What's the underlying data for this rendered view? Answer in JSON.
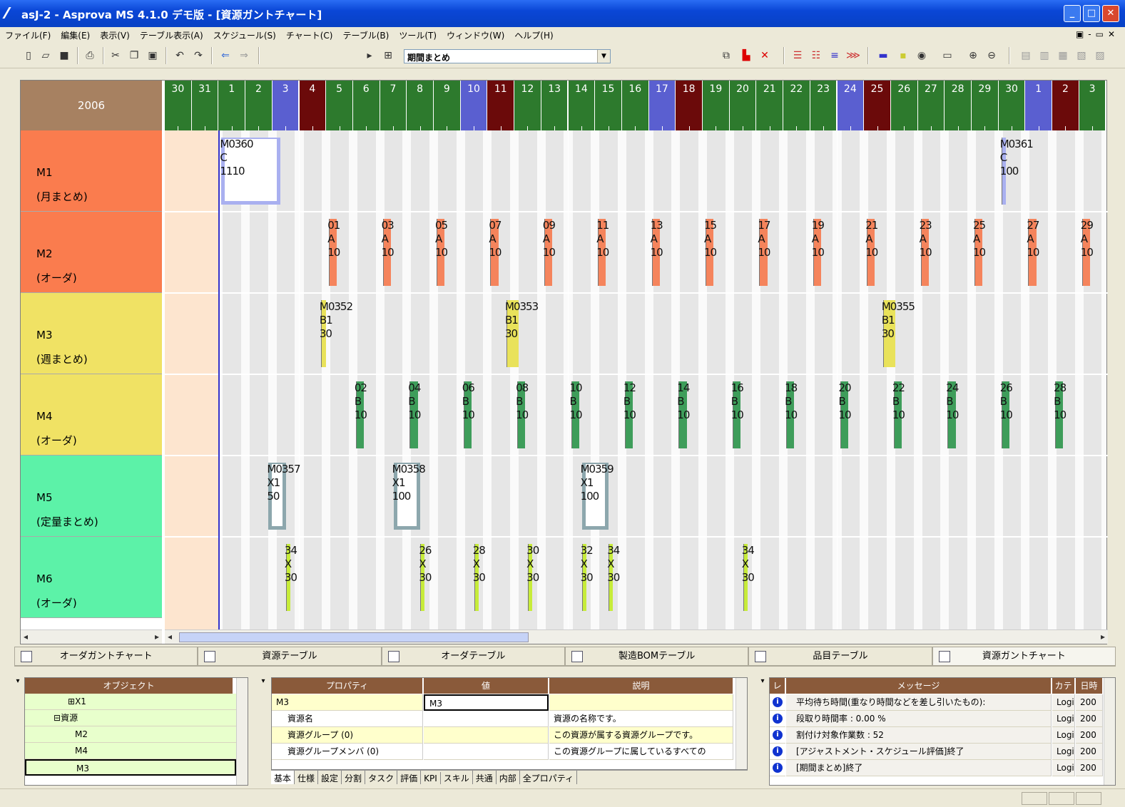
{
  "window": {
    "title": "asJ-2 - Asprova MS 4.1.0 デモ版 - [資源ガントチャート]"
  },
  "menu": [
    "ファイル(F)",
    "編集(E)",
    "表示(V)",
    "テーブル表示(A)",
    "スケジュール(S)",
    "チャート(C)",
    "テーブル(B)",
    "ツール(T)",
    "ウィンドウ(W)",
    "ヘルプ(H)"
  ],
  "toolbar": {
    "combo_value": "期間まとめ"
  },
  "gantt": {
    "year": "2006",
    "days": [
      {
        "d": "30",
        "c": "#2d7a2d"
      },
      {
        "d": "31",
        "c": "#2d7a2d"
      },
      {
        "d": "1",
        "c": "#2d7a2d"
      },
      {
        "d": "2",
        "c": "#2d7a2d"
      },
      {
        "d": "3",
        "c": "#5a5fd0"
      },
      {
        "d": "4",
        "c": "#6b0a0a"
      },
      {
        "d": "5",
        "c": "#2d7a2d"
      },
      {
        "d": "6",
        "c": "#2d7a2d"
      },
      {
        "d": "7",
        "c": "#2d7a2d"
      },
      {
        "d": "8",
        "c": "#2d7a2d"
      },
      {
        "d": "9",
        "c": "#2d7a2d"
      },
      {
        "d": "10",
        "c": "#5a5fd0"
      },
      {
        "d": "11",
        "c": "#6b0a0a"
      },
      {
        "d": "12",
        "c": "#2d7a2d"
      },
      {
        "d": "13",
        "c": "#2d7a2d"
      },
      {
        "d": "14",
        "c": "#2d7a2d"
      },
      {
        "d": "15",
        "c": "#2d7a2d"
      },
      {
        "d": "16",
        "c": "#2d7a2d"
      },
      {
        "d": "17",
        "c": "#5a5fd0"
      },
      {
        "d": "18",
        "c": "#6b0a0a"
      },
      {
        "d": "19",
        "c": "#2d7a2d"
      },
      {
        "d": "20",
        "c": "#2d7a2d"
      },
      {
        "d": "21",
        "c": "#2d7a2d"
      },
      {
        "d": "22",
        "c": "#2d7a2d"
      },
      {
        "d": "23",
        "c": "#2d7a2d"
      },
      {
        "d": "24",
        "c": "#5a5fd0"
      },
      {
        "d": "25",
        "c": "#6b0a0a"
      },
      {
        "d": "26",
        "c": "#2d7a2d"
      },
      {
        "d": "27",
        "c": "#2d7a2d"
      },
      {
        "d": "28",
        "c": "#2d7a2d"
      },
      {
        "d": "29",
        "c": "#2d7a2d"
      },
      {
        "d": "30",
        "c": "#2d7a2d"
      },
      {
        "d": "1",
        "c": "#5a5fd0"
      },
      {
        "d": "2",
        "c": "#6b0a0a"
      },
      {
        "d": "3",
        "c": "#2d7a2d"
      }
    ],
    "resources": [
      {
        "name": "M1",
        "sub": "(月まとめ)",
        "color": "#fa7c4e"
      },
      {
        "name": "M2",
        "sub": "(オーダ)",
        "color": "#fa7c4e"
      },
      {
        "name": "M3",
        "sub": "(週まとめ)",
        "color": "#f0e264"
      },
      {
        "name": "M4",
        "sub": "(オーダ)",
        "color": "#f0e264"
      },
      {
        "name": "M5",
        "sub": "(定量まとめ)",
        "color": "#5cf2a8"
      },
      {
        "name": "M6",
        "sub": "(オーダ)",
        "color": "#5cf2a8"
      }
    ],
    "tasks": [
      {
        "row": 0,
        "day": 2,
        "w": 2.2,
        "text": "M0360\nC\n1110",
        "color": "#a9b0f0",
        "hollow": true
      },
      {
        "row": 0,
        "day": 31,
        "w": 0.15,
        "text": "M0361\nC\n100",
        "color": "#a9b0f0",
        "hollow": false
      },
      {
        "row": 1,
        "day": 6,
        "w": 0.3,
        "text": "01\nA\n10",
        "color": "#f5845c"
      },
      {
        "row": 1,
        "day": 8,
        "w": 0.3,
        "text": "03\nA\n10",
        "color": "#f5845c"
      },
      {
        "row": 1,
        "day": 10,
        "w": 0.3,
        "text": "05\nA\n10",
        "color": "#f5845c"
      },
      {
        "row": 1,
        "day": 12,
        "w": 0.3,
        "text": "07\nA\n10",
        "color": "#f5845c"
      },
      {
        "row": 1,
        "day": 14,
        "w": 0.3,
        "text": "09\nA\n10",
        "color": "#f5845c"
      },
      {
        "row": 1,
        "day": 16,
        "w": 0.3,
        "text": "11\nA\n10",
        "color": "#f5845c"
      },
      {
        "row": 1,
        "day": 18,
        "w": 0.3,
        "text": "13\nA\n10",
        "color": "#f5845c"
      },
      {
        "row": 1,
        "day": 20,
        "w": 0.3,
        "text": "15\nA\n10",
        "color": "#f5845c"
      },
      {
        "row": 1,
        "day": 22,
        "w": 0.3,
        "text": "17\nA\n10",
        "color": "#f5845c"
      },
      {
        "row": 1,
        "day": 24,
        "w": 0.3,
        "text": "19\nA\n10",
        "color": "#f5845c"
      },
      {
        "row": 1,
        "day": 26,
        "w": 0.3,
        "text": "21\nA\n10",
        "color": "#f5845c"
      },
      {
        "row": 1,
        "day": 28,
        "w": 0.3,
        "text": "23\nA\n10",
        "color": "#f5845c"
      },
      {
        "row": 1,
        "day": 30,
        "w": 0.3,
        "text": "25\nA\n10",
        "color": "#f5845c"
      },
      {
        "row": 1,
        "day": 32,
        "w": 0.3,
        "text": "27\nA\n10",
        "color": "#f5845c"
      },
      {
        "row": 1,
        "day": 34,
        "w": 0.3,
        "text": "29\nA\n10",
        "color": "#f5845c"
      },
      {
        "row": 2,
        "day": 5.7,
        "w": 0.2,
        "text": "M0352\nB1\n30",
        "color": "#e9e25a"
      },
      {
        "row": 2,
        "day": 12.6,
        "w": 0.45,
        "text": "M0353\nB1\n30",
        "color": "#e9e25a"
      },
      {
        "row": 2,
        "day": 26.6,
        "w": 0.45,
        "text": "M0355\nB1\n30",
        "color": "#e9e25a"
      },
      {
        "row": 3,
        "day": 7,
        "w": 0.3,
        "text": "02\nB\n10",
        "color": "#3e9d5a"
      },
      {
        "row": 3,
        "day": 9,
        "w": 0.3,
        "text": "04\nB\n10",
        "color": "#3e9d5a"
      },
      {
        "row": 3,
        "day": 11,
        "w": 0.3,
        "text": "06\nB\n10",
        "color": "#3e9d5a"
      },
      {
        "row": 3,
        "day": 13,
        "w": 0.3,
        "text": "08\nB\n10",
        "color": "#3e9d5a"
      },
      {
        "row": 3,
        "day": 15,
        "w": 0.3,
        "text": "10\nB\n10",
        "color": "#3e9d5a"
      },
      {
        "row": 3,
        "day": 17,
        "w": 0.3,
        "text": "12\nB\n10",
        "color": "#3e9d5a"
      },
      {
        "row": 3,
        "day": 19,
        "w": 0.3,
        "text": "14\nB\n10",
        "color": "#3e9d5a"
      },
      {
        "row": 3,
        "day": 21,
        "w": 0.3,
        "text": "16\nB\n10",
        "color": "#3e9d5a"
      },
      {
        "row": 3,
        "day": 23,
        "w": 0.3,
        "text": "18\nB\n10",
        "color": "#3e9d5a"
      },
      {
        "row": 3,
        "day": 25,
        "w": 0.3,
        "text": "20\nB\n10",
        "color": "#3e9d5a"
      },
      {
        "row": 3,
        "day": 27,
        "w": 0.3,
        "text": "22\nB\n10",
        "color": "#3e9d5a"
      },
      {
        "row": 3,
        "day": 29,
        "w": 0.3,
        "text": "24\nB\n10",
        "color": "#3e9d5a"
      },
      {
        "row": 3,
        "day": 31,
        "w": 0.3,
        "text": "26\nB\n10",
        "color": "#3e9d5a"
      },
      {
        "row": 3,
        "day": 33,
        "w": 0.3,
        "text": "28\nB\n10",
        "color": "#3e9d5a"
      },
      {
        "row": 4,
        "day": 3.75,
        "w": 0.65,
        "text": "M0357\nX1\n50",
        "color": "#8da7ad",
        "hollow": true
      },
      {
        "row": 4,
        "day": 8.4,
        "w": 1.0,
        "text": "M0358\nX1\n100",
        "color": "#8da7ad",
        "hollow": true
      },
      {
        "row": 4,
        "day": 15.4,
        "w": 1.0,
        "text": "M0359\nX1\n100",
        "color": "#8da7ad",
        "hollow": true
      },
      {
        "row": 5,
        "day": 4.4,
        "w": 0.15,
        "text": "34\nX\n30",
        "color": "#c7ec3a"
      },
      {
        "row": 5,
        "day": 9.4,
        "w": 0.15,
        "text": "26\nX\n30",
        "color": "#c7ec3a"
      },
      {
        "row": 5,
        "day": 11.4,
        "w": 0.15,
        "text": "28\nX\n30",
        "color": "#c7ec3a"
      },
      {
        "row": 5,
        "day": 13.4,
        "w": 0.15,
        "text": "30\nX\n30",
        "color": "#c7ec3a"
      },
      {
        "row": 5,
        "day": 15.4,
        "w": 0.15,
        "text": "32\nX\n30",
        "color": "#c7ec3a"
      },
      {
        "row": 5,
        "day": 16.4,
        "w": 0.15,
        "text": "34\nX\n30",
        "color": "#c7ec3a"
      },
      {
        "row": 5,
        "day": 21.4,
        "w": 0.15,
        "text": "34\nX\n30",
        "color": "#c7ec3a"
      }
    ]
  },
  "doc_tabs": [
    "オーダガントチャート",
    "資源テーブル",
    "オーダテーブル",
    "製造BOMテーブル",
    "品目テーブル",
    "資源ガントチャート"
  ],
  "object_pane": {
    "header": "オブジェクト",
    "items": [
      "X1",
      "資源",
      "M2",
      "M4",
      "M3"
    ]
  },
  "property_pane": {
    "headers": [
      "プロパティ",
      "値",
      "説明"
    ],
    "rows": [
      {
        "p": "M3",
        "v": "M3",
        "d": ""
      },
      {
        "p": "資源名",
        "v": "",
        "d": "資源の名称です。"
      },
      {
        "p": "資源グループ (0)",
        "v": "",
        "d": "この資源が属する資源グループです。"
      },
      {
        "p": "資源グループメンバ (0)",
        "v": "",
        "d": "この資源グループに属しているすべての"
      }
    ],
    "tabs": [
      "基本",
      "仕様",
      "設定",
      "分割",
      "タスク",
      "評価",
      "KPI",
      "スキル",
      "共通",
      "内部",
      "全プロパティ"
    ]
  },
  "message_pane": {
    "headers": [
      "レ",
      "メッセージ",
      "カテ",
      "日時"
    ],
    "rows": [
      {
        "m": "平均待ち時間(重なり時間などを差し引いたもの):",
        "c": "Logi",
        "t": "200"
      },
      {
        "m": "段取り時間率 : 0.00 %",
        "c": "Logi",
        "t": "200"
      },
      {
        "m": "割付け対象作業数 : 52",
        "c": "Logi",
        "t": "200"
      },
      {
        "m": "[アジャストメント・スケジュール評価]終了",
        "c": "Logi",
        "t": "200"
      },
      {
        "m": "[期間まとめ]終了",
        "c": "Logi",
        "t": "200"
      }
    ]
  }
}
